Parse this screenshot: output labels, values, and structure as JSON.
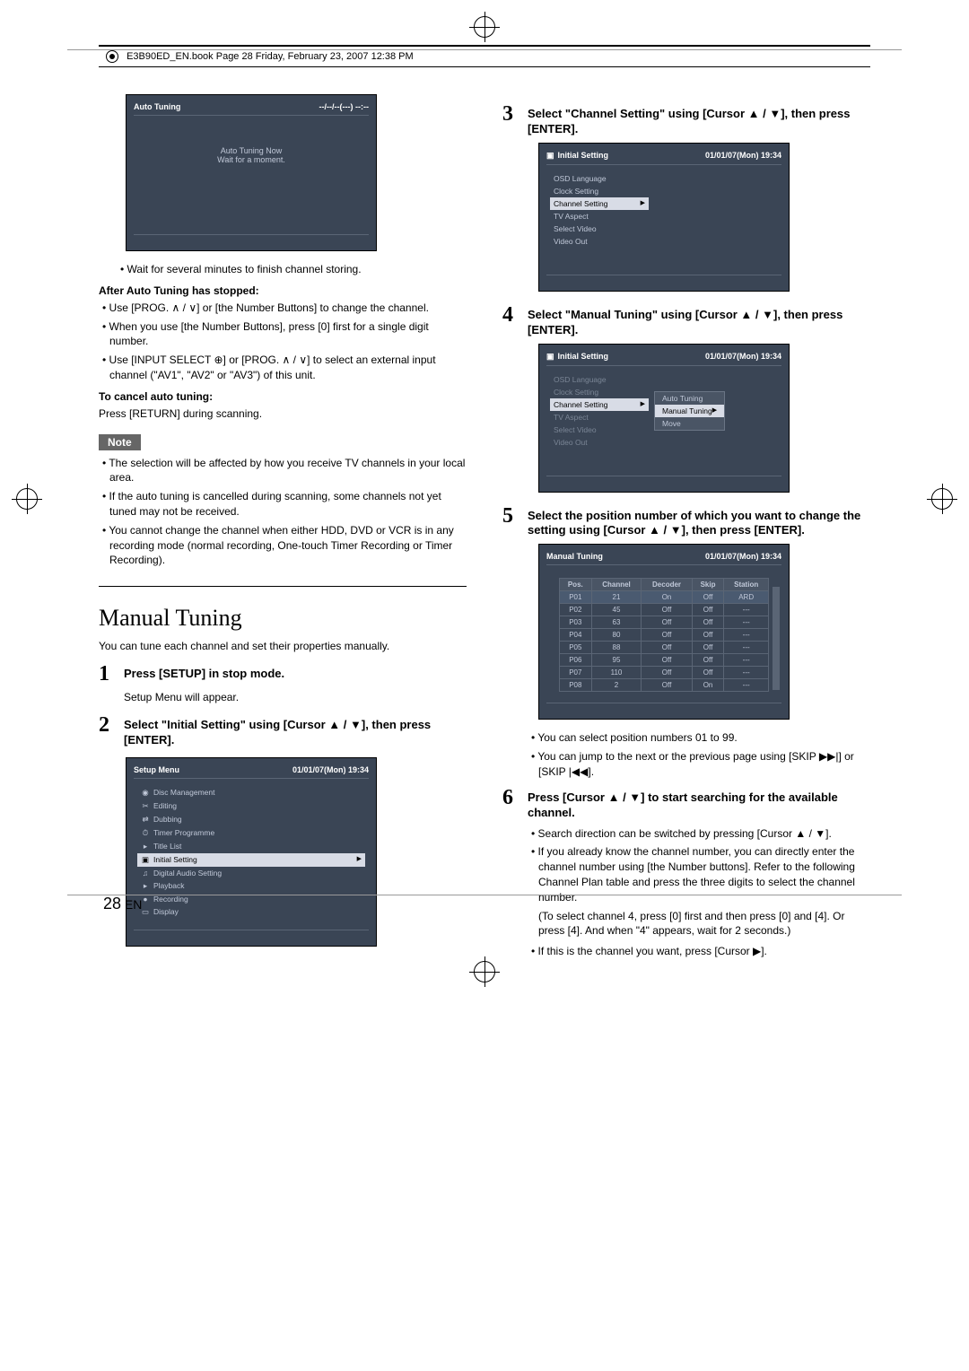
{
  "header": {
    "text": "E3B90ED_EN.book  Page 28  Friday, February 23, 2007  12:38 PM"
  },
  "autoTuningPanel": {
    "title": "Auto Tuning",
    "time": "--/--/--(---)    --:--",
    "line1": "Auto Tuning Now",
    "line2": "Wait for a moment."
  },
  "leftCol": {
    "waitText": "Wait for several minutes to finish channel storing.",
    "afterTitle": "After Auto Tuning has stopped:",
    "b1": "Use [PROG. ∧ / ∨] or [the Number Buttons] to change the channel.",
    "b2": "When you use [the Number Buttons], press [0] first for a single digit number.",
    "b3": "Use [INPUT SELECT ⊕] or [PROG. ∧ / ∨] to select an external input channel (\"AV1\", \"AV2\" or \"AV3\") of this unit.",
    "cancelTitle": "To cancel auto tuning:",
    "cancelText": "Press [RETURN] during scanning.",
    "noteLabel": "Note",
    "n1": "The selection will be affected by how you receive TV channels in your local area.",
    "n2": "If the auto tuning is cancelled during scanning, some channels not yet tuned may not be received.",
    "n3": "You cannot change the channel when either HDD, DVD or VCR is in any recording mode (normal recording, One-touch Timer Recording or Timer Recording).",
    "manualTitle": "Manual Tuning",
    "manualIntro": "You can tune each channel and set their properties manually.",
    "step1": "Press [SETUP] in stop mode.",
    "step1sub": "Setup Menu will appear.",
    "step2": "Select \"Initial Setting\" using [Cursor ▲ / ▼], then press [ENTER]."
  },
  "setupMenu": {
    "title": "Setup Menu",
    "date": "01/01/07(Mon)    19:34",
    "items": [
      "Disc Management",
      "Editing",
      "Dubbing",
      "Timer Programme",
      "Title List",
      "Initial Setting",
      "Digital Audio Setting",
      "Playback",
      "Recording",
      "Display"
    ],
    "selectedIndex": 5
  },
  "rightCol": {
    "step3": "Select \"Channel Setting\" using [Cursor ▲ / ▼], then press [ENTER].",
    "step4": "Select \"Manual Tuning\" using [Cursor ▲ / ▼], then press [ENTER].",
    "step5": "Select the position number of which you want to change the setting using [Cursor ▲ / ▼], then press [ENTER].",
    "step5b1": "You can select position numbers 01 to 99.",
    "step5b2": "You can jump to the next or the previous page using [SKIP ▶▶|] or [SKIP |◀◀].",
    "step6": "Press [Cursor ▲ / ▼] to start searching for the available channel.",
    "step6b1": "Search direction can be switched by pressing [Cursor ▲ / ▼].",
    "step6b2": "If you already know the channel number, you can directly enter the channel number using [the Number buttons]. Refer to the following Channel Plan table and press the three digits to select the channel number.",
    "step6b2a": "(To select channel 4, press [0] first and then press [0] and [4]. Or press [4]. And when \"4\" appears, wait for 2 seconds.)",
    "step6b3": "If this is the channel you want, press [Cursor ▶]."
  },
  "initialSetting1": {
    "title": "Initial Setting",
    "date": "01/01/07(Mon)    19:34",
    "items": [
      "OSD Language",
      "Clock Setting",
      "Channel Setting",
      "TV Aspect",
      "Select Video",
      "Video Out"
    ],
    "selectedIndex": 2
  },
  "initialSetting2": {
    "title": "Initial Setting",
    "date": "01/01/07(Mon)    19:34",
    "items": [
      "OSD Language",
      "Clock Setting",
      "Channel Setting",
      "TV Aspect",
      "Select Video",
      "Video Out"
    ],
    "selectedIndex": 2,
    "subItems": [
      "Auto Tuning",
      "Manual Tuning",
      "Move"
    ],
    "subSelectedIndex": 1
  },
  "manualTuningPanel": {
    "title": "Manual Tuning",
    "date": "01/01/07(Mon)    19:34",
    "headers": [
      "Pos.",
      "Channel",
      "Decoder",
      "Skip",
      "Station"
    ],
    "rows": [
      [
        "P01",
        "21",
        "On",
        "Off",
        "ARD"
      ],
      [
        "P02",
        "45",
        "Off",
        "Off",
        "---"
      ],
      [
        "P03",
        "63",
        "Off",
        "Off",
        "---"
      ],
      [
        "P04",
        "80",
        "Off",
        "Off",
        "---"
      ],
      [
        "P05",
        "88",
        "Off",
        "Off",
        "---"
      ],
      [
        "P06",
        "95",
        "Off",
        "Off",
        "---"
      ],
      [
        "P07",
        "110",
        "Off",
        "Off",
        "---"
      ],
      [
        "P08",
        "2",
        "Off",
        "On",
        "---"
      ]
    ]
  },
  "pageNumber": {
    "num": "28",
    "suffix": "EN"
  }
}
